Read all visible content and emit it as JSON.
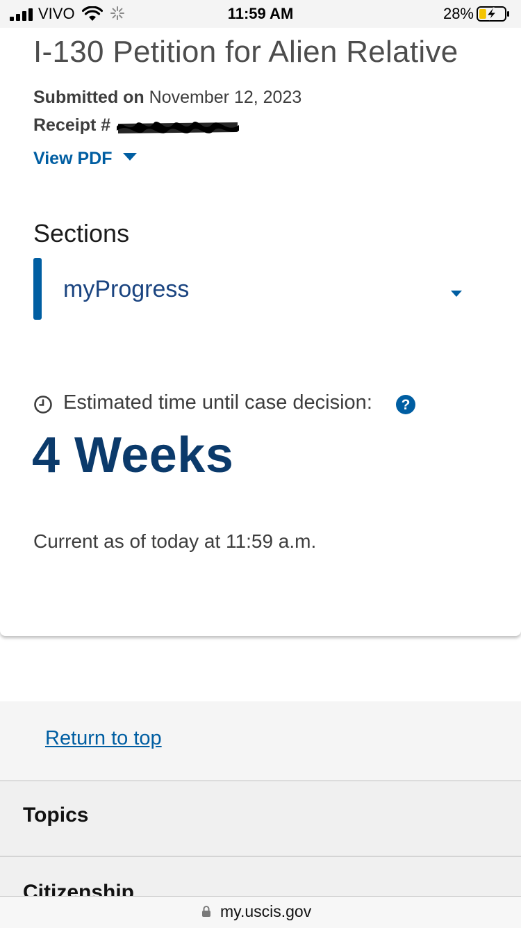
{
  "status_bar": {
    "carrier": "VIVO",
    "time": "11:59 AM",
    "battery_percent": "28%",
    "battery_level": 0.28,
    "icons": [
      "signal-icon",
      "wifi-icon",
      "activity-spinner-icon",
      "battery-charging-icon"
    ]
  },
  "case": {
    "title": "I-130 Petition for Alien Relative",
    "submitted_label": "Submitted on",
    "submitted_date": "November 12, 2023",
    "receipt_label": "Receipt #",
    "view_pdf_label": "View PDF"
  },
  "sections": {
    "heading": "Sections",
    "selected": "myProgress"
  },
  "estimate": {
    "label": "Estimated time until case decision:",
    "value": "4 Weeks",
    "current_as_of": "Current as of today at 11:59 a.m."
  },
  "footer": {
    "return_to_top": "Return to top",
    "topics": "Topics",
    "citizenship": "Citizenship"
  },
  "browser": {
    "url": "my.uscis.gov"
  },
  "colors": {
    "link_blue": "#005ea2",
    "headline_navy": "#0b3a6b",
    "select_text": "#1a4480",
    "text_gray": "#3d3d3d",
    "footer_bg": "#f0f0f0"
  }
}
